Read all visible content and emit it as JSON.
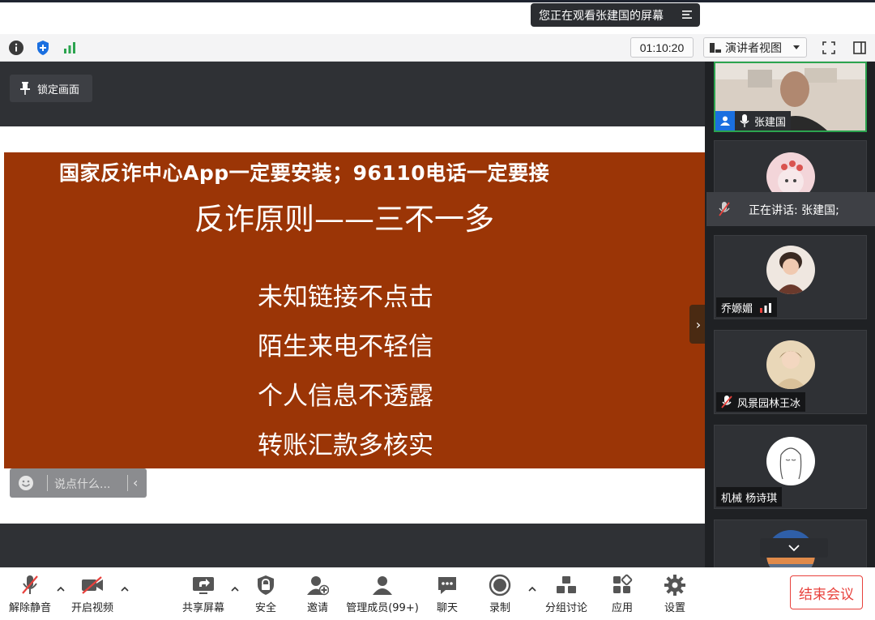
{
  "banner": {
    "viewing_text": "您正在观看张建国的屏幕"
  },
  "status_bar": {
    "timer": "01:10:20",
    "view_mode": "演讲者视图"
  },
  "share": {
    "lock_label": "锁定画面",
    "chat_placeholder": "说点什么..."
  },
  "slide": {
    "line1": "国家反诈中心App一定要安装；96110电话一定要接",
    "line2": "反诈原则——三不一多",
    "rules": [
      "未知链接不点击",
      "陌生来电不轻信",
      "个人信息不透露",
      "转账汇款多核实"
    ]
  },
  "panel": {
    "speaking_text": "正在讲话: 张建国;",
    "participants": [
      {
        "name": "张建国"
      },
      {
        "name": ""
      },
      {
        "name": "乔嫄媚"
      },
      {
        "name": "风景园林王冰"
      },
      {
        "name": "机械 杨诗琪"
      }
    ]
  },
  "toolbar": {
    "mute": "解除静音",
    "video": "开启视频",
    "share": "共享屏幕",
    "security": "安全",
    "invite": "邀请",
    "members": "管理成员(99+)",
    "chat": "聊天",
    "record": "录制",
    "breakout": "分组讨论",
    "apps": "应用",
    "settings": "设置",
    "end": "结束会议"
  },
  "colors": {
    "slide_bg": "#9b3506",
    "accent_red": "#e8413c",
    "active_green": "#2ca44f",
    "shield_blue": "#1a6fe0"
  }
}
